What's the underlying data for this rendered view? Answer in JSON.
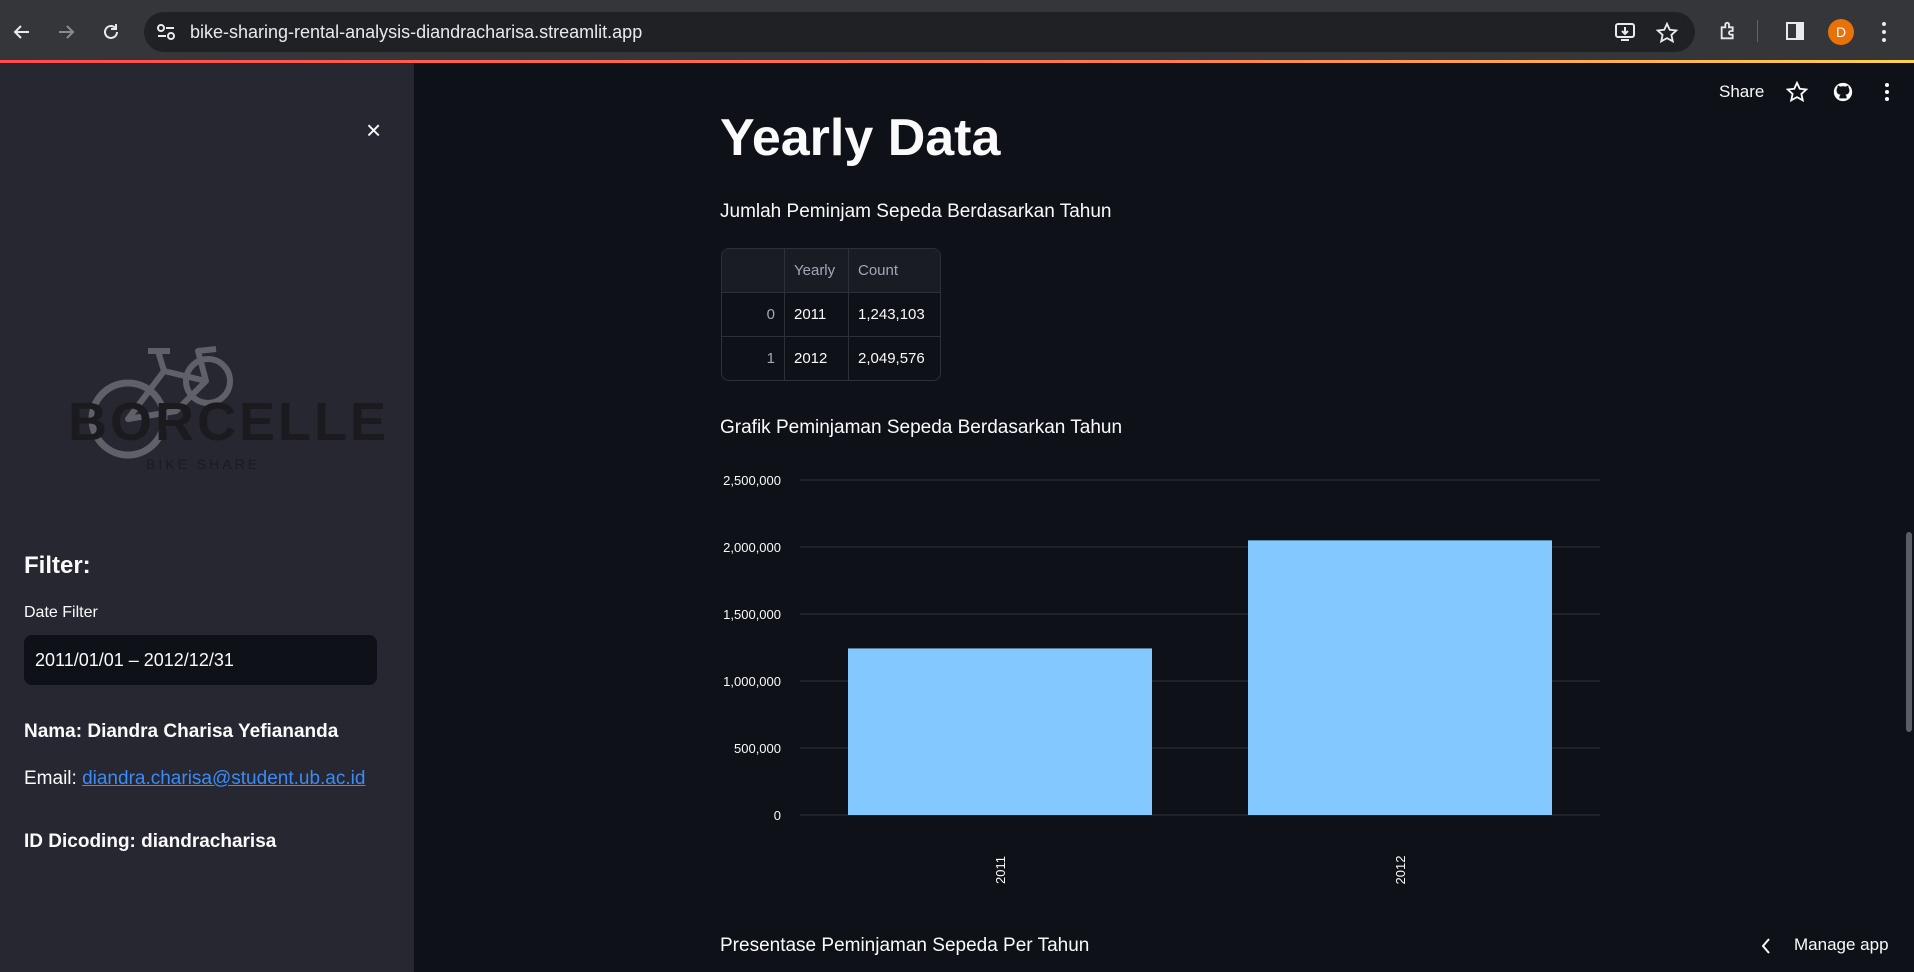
{
  "browser": {
    "url": "bike-sharing-rental-analysis-diandracharisa.streamlit.app",
    "profile_initial": "D"
  },
  "sidebar": {
    "logo": {
      "brand": "BORCELLE",
      "tagline": "BIKE SHARE"
    },
    "filter_title": "Filter:",
    "date_filter_label": "Date Filter",
    "date_filter_value": "2011/01/01 – 2012/12/31",
    "name_text": "Nama: Diandra Charisa Yefiananda",
    "email_label": "Email:",
    "email_value": "diandra.charisa@student.ub.ac.id",
    "dicoding_text": "ID Dicoding: diandracharisa"
  },
  "header": {
    "share_label": "Share"
  },
  "main": {
    "title": "Yearly Data",
    "table_caption": "Jumlah Peminjam Sepeda Berdasarkan Tahun",
    "table": {
      "columns": [
        "",
        "Yearly",
        "Count"
      ],
      "rows": [
        [
          "0",
          "2011",
          "1,243,103"
        ],
        [
          "1",
          "2012",
          "2,049,576"
        ]
      ]
    },
    "chart_caption": "Grafik Peminjaman Sepeda Berdasarkan Tahun",
    "next_caption": "Presentase Peminjaman Sepeda Per Tahun"
  },
  "chart_data": {
    "type": "bar",
    "categories": [
      "2011",
      "2012"
    ],
    "values": [
      1243103,
      2049576
    ],
    "ylim": [
      0,
      2500000
    ],
    "yticks": [
      "0",
      "500,000",
      "1,000,000",
      "1,500,000",
      "2,000,000",
      "2,500,000"
    ],
    "grid": true,
    "color": "#83c9ff"
  },
  "footer": {
    "manage_label": "Manage app"
  },
  "colors": {
    "accent": "#ff4b4b",
    "link": "#3b8bf7",
    "bar": "#83c9ff"
  }
}
